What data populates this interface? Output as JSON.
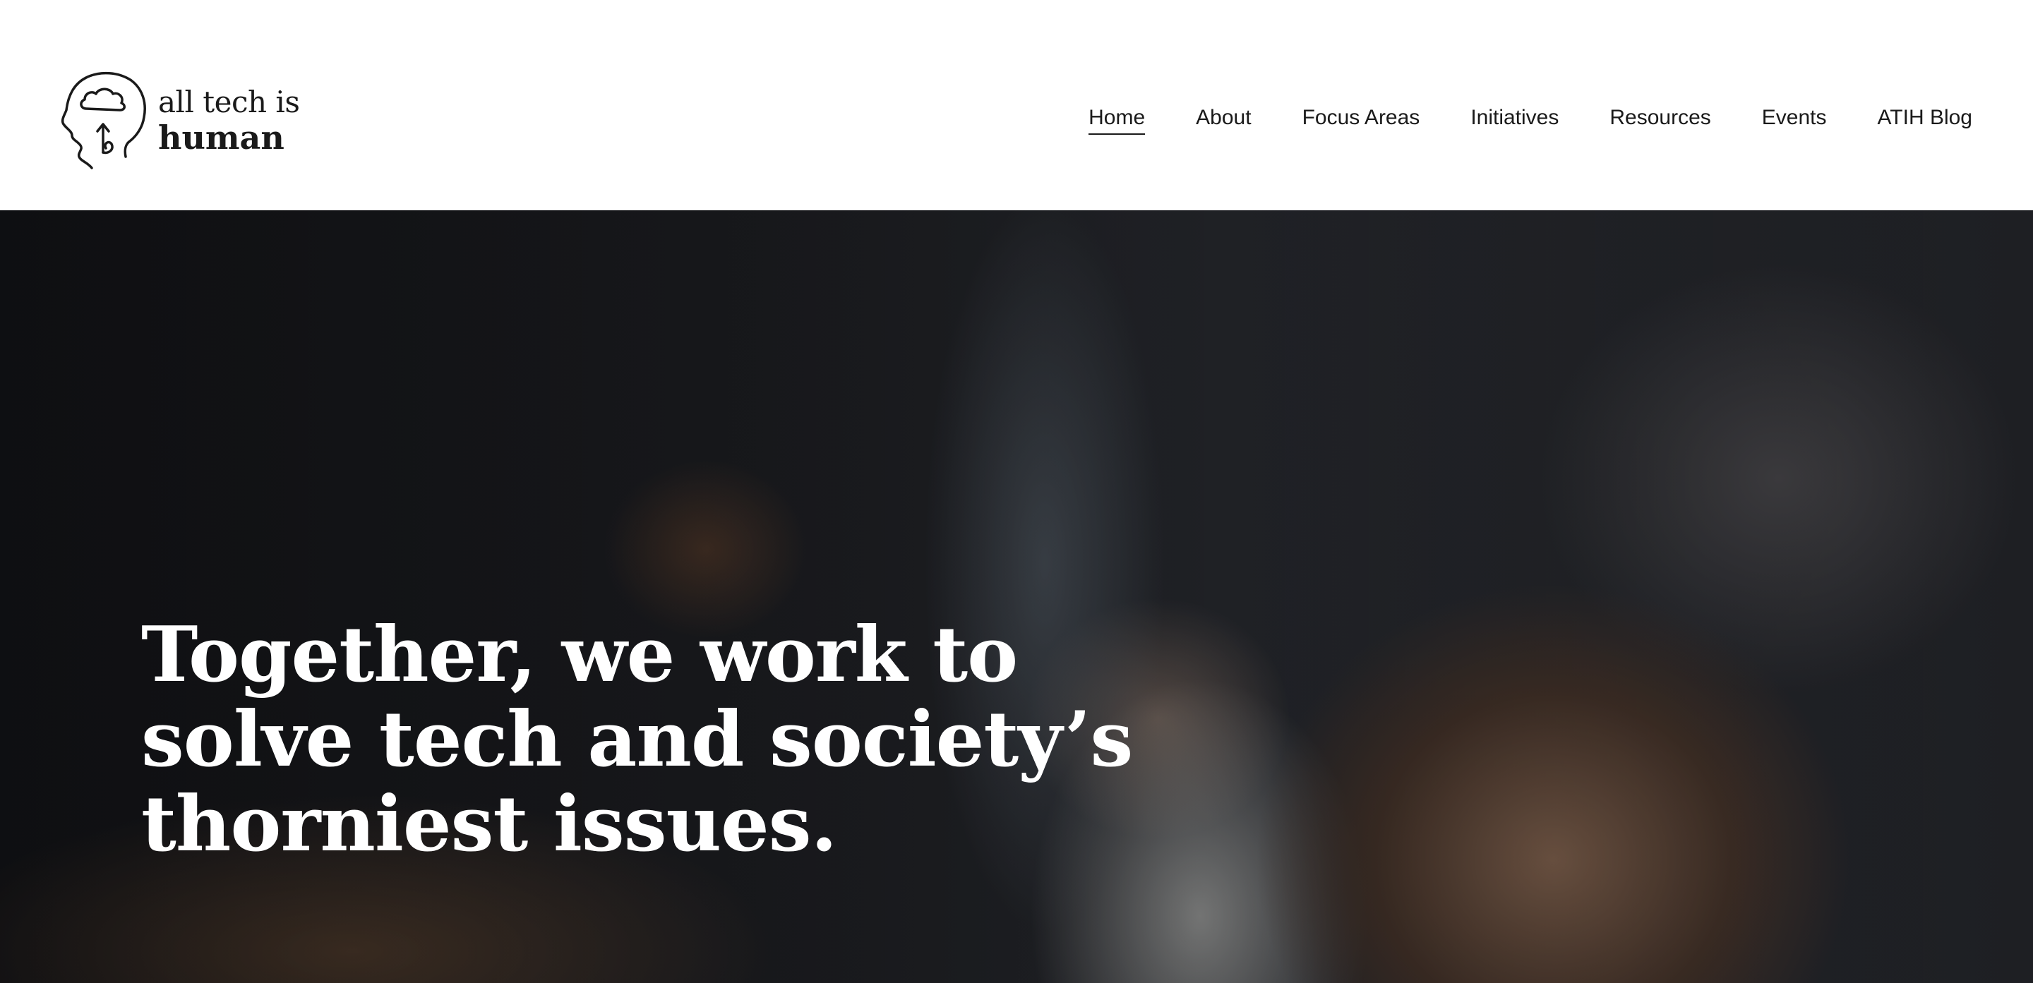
{
  "brand": {
    "logo_line1": "all tech is",
    "logo_line2": "human",
    "logo_icon": "head-with-cloud-icon"
  },
  "nav": {
    "items": [
      {
        "label": "Home",
        "active": true
      },
      {
        "label": "About",
        "active": false
      },
      {
        "label": "Focus Areas",
        "active": false
      },
      {
        "label": "Initiatives",
        "active": false
      },
      {
        "label": "Resources",
        "active": false
      },
      {
        "label": "Events",
        "active": false
      },
      {
        "label": "ATIH Blog",
        "active": false
      }
    ]
  },
  "hero": {
    "headline": "Together, we work to solve tech and society’s thorniest issues.",
    "text_color": "#ffffff"
  },
  "colors": {
    "text": "#1a1a1a",
    "header_bg": "#ffffff",
    "hero_bg": "#1d1e22"
  }
}
